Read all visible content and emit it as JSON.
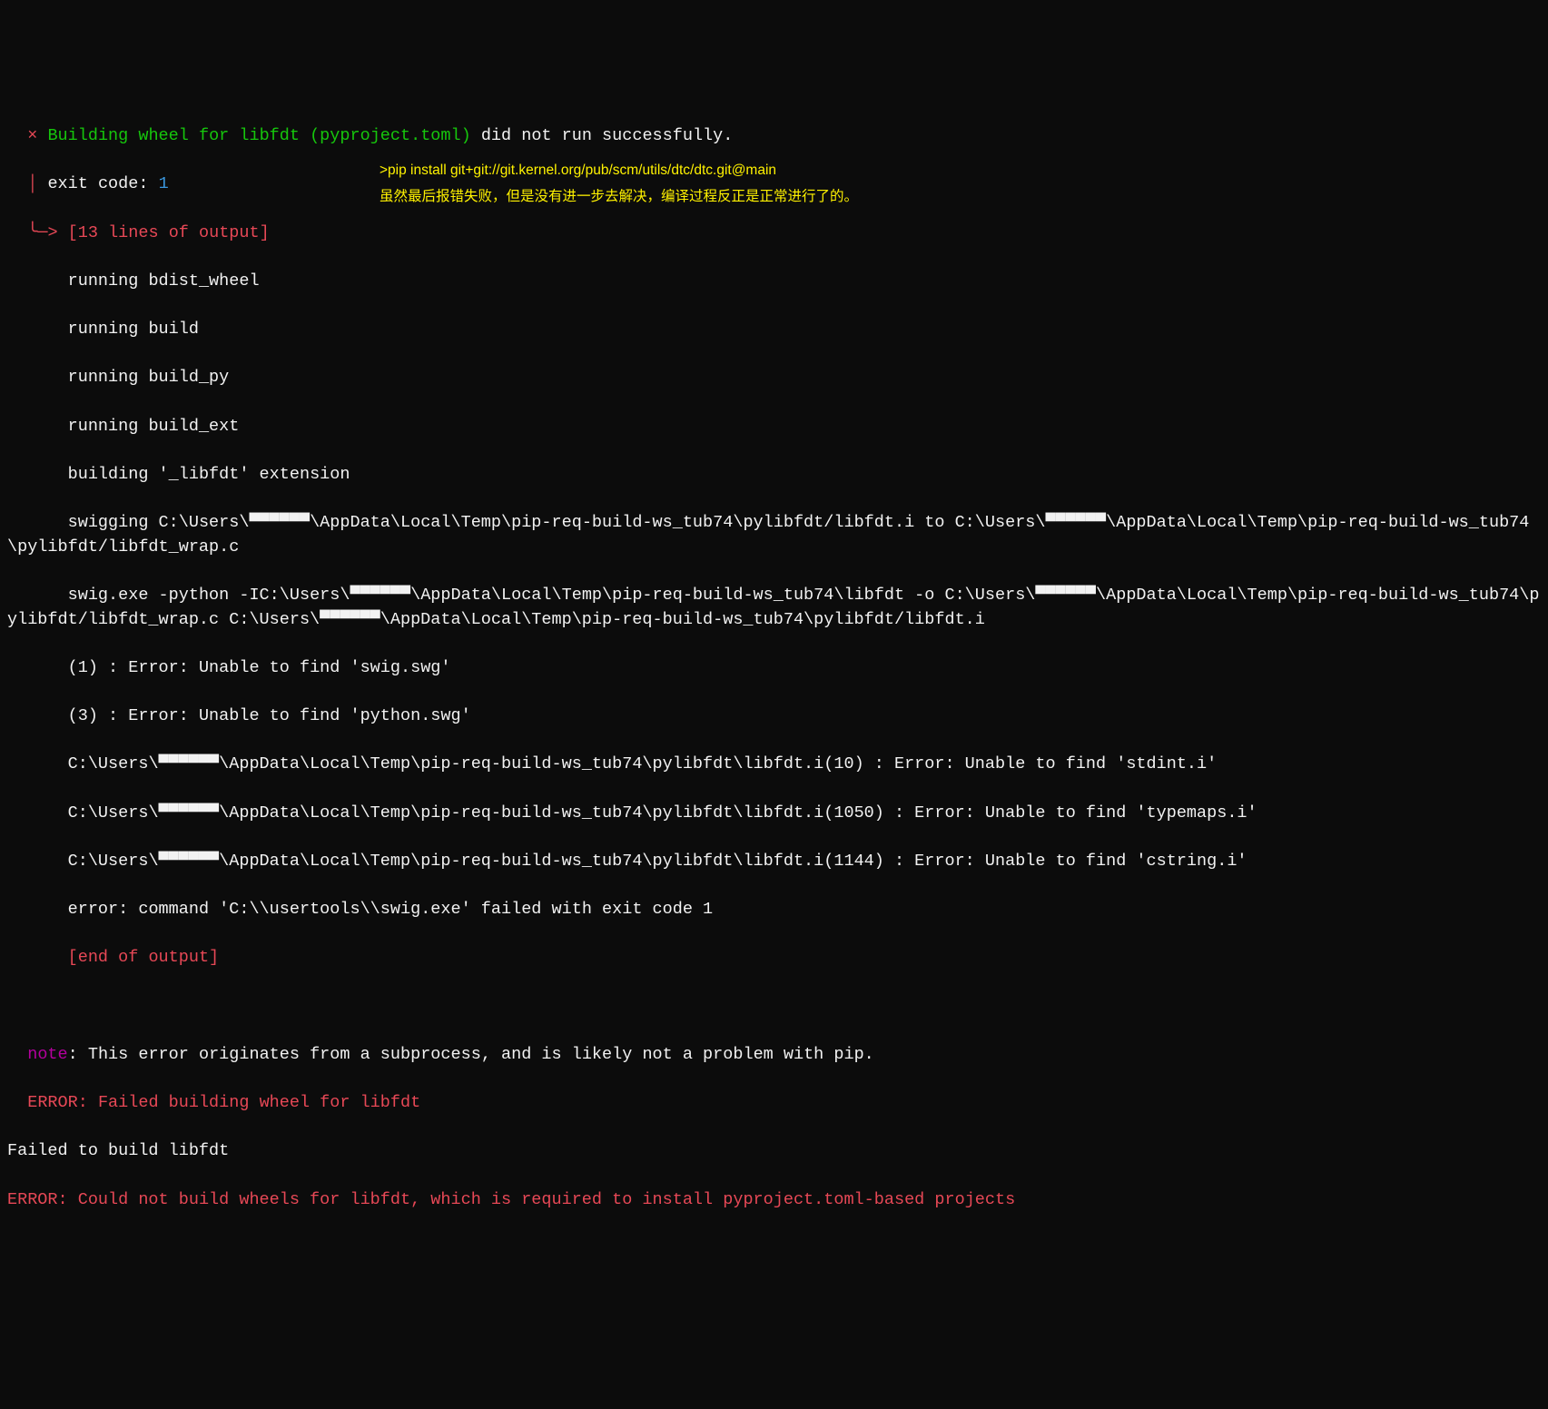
{
  "header": {
    "x_mark": "  × ",
    "title_green": "Building wheel for libfdt (pyproject.toml)",
    "title_rest": " did not run successfully.",
    "tree1": "  │ ",
    "exit_label": "exit code: ",
    "exit_code": "1",
    "tree2": "  ╰─> ",
    "lines_output": "[13 lines of output]"
  },
  "annot": {
    "cmd": ">pip install git+git://git.kernel.org/pub/scm/utils/dtc/dtc.git@main",
    "note": "虽然最后报错失败，但是没有进一步去解决，编译过程反正是正常进行了的。"
  },
  "out": [
    "      running bdist_wheel",
    "      running build",
    "      running build_py",
    "      running build_ext",
    "      building '_libfdt' extension",
    "      swigging C:\\Users\\▀▀▀▀▀▀\\AppData\\Local\\Temp\\pip-req-build-ws_tub74\\pylibfdt/libfdt.i to C:\\Users\\▀▀▀▀▀▀\\AppData\\Local\\Temp\\pip-req-build-ws_tub74\\pylibfdt/libfdt_wrap.c",
    "      swig.exe -python -IC:\\Users\\▀▀▀▀▀▀\\AppData\\Local\\Temp\\pip-req-build-ws_tub74\\libfdt -o C:\\Users\\▀▀▀▀▀▀\\AppData\\Local\\Temp\\pip-req-build-ws_tub74\\pylibfdt/libfdt_wrap.c C:\\Users\\▀▀▀▀▀▀\\AppData\\Local\\Temp\\pip-req-build-ws_tub74\\pylibfdt/libfdt.i",
    "      (1) : Error: Unable to find 'swig.swg'",
    "      (3) : Error: Unable to find 'python.swg'",
    "      C:\\Users\\▀▀▀▀▀▀\\AppData\\Local\\Temp\\pip-req-build-ws_tub74\\pylibfdt\\libfdt.i(10) : Error: Unable to find 'stdint.i'",
    "      C:\\Users\\▀▀▀▀▀▀\\AppData\\Local\\Temp\\pip-req-build-ws_tub74\\pylibfdt\\libfdt.i(1050) : Error: Unable to find 'typemaps.i'",
    "      C:\\Users\\▀▀▀▀▀▀\\AppData\\Local\\Temp\\pip-req-build-ws_tub74\\pylibfdt\\libfdt.i(1144) : Error: Unable to find 'cstring.i'",
    "      error: command 'C:\\\\usertools\\\\swig.exe' failed with exit code 1"
  ],
  "end_of_output": "      [end of output]",
  "blank": " ",
  "footer": {
    "note_pfx": "  note",
    "note_rest": ": This error originates from a subprocess, and is likely not a problem with pip.",
    "err1_pfx": "  ERROR: ",
    "err1_rest": "Failed building wheel for libfdt",
    "failed": "Failed to build libfdt",
    "err2_pfx": "ERROR: ",
    "err2_rest": "Could not build wheels for libfdt, which is required to install pyproject.toml-based projects"
  }
}
